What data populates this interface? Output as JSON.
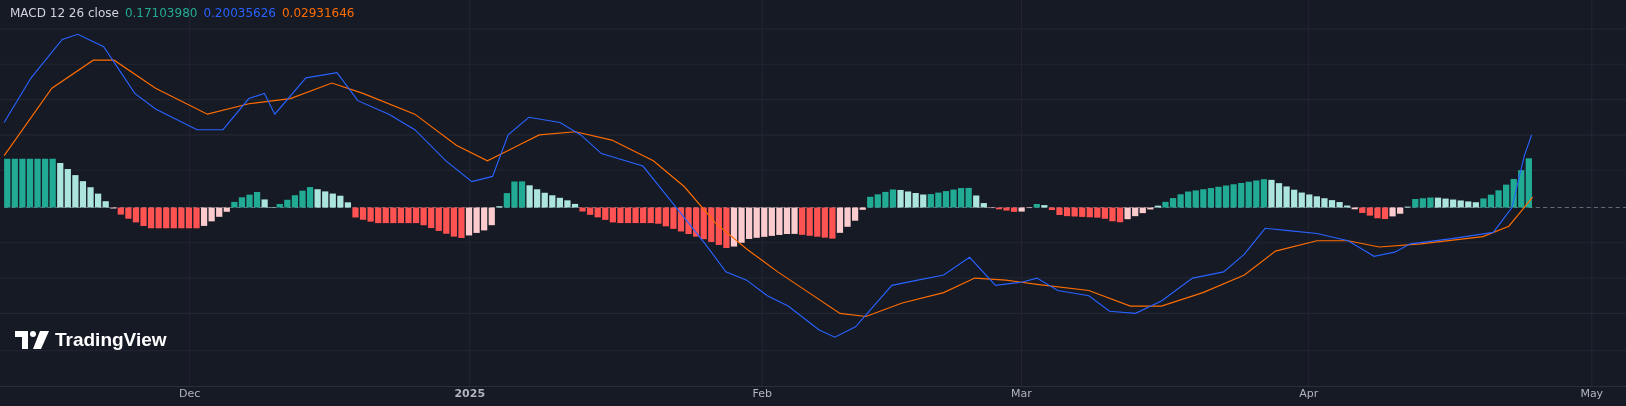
{
  "legend": {
    "title": "MACD 12 26 close",
    "values": [
      {
        "text": "0.17103980",
        "color": "#22ab94"
      },
      {
        "text": "0.20035626",
        "color": "#2962ff"
      },
      {
        "text": "0.02931646",
        "color": "#ff6d00"
      }
    ]
  },
  "logo": {
    "text": "TradingView"
  },
  "time_axis": {
    "labels": [
      {
        "text": "Dec",
        "kind": "month"
      },
      {
        "text": "2025",
        "kind": "year"
      },
      {
        "text": "Feb",
        "kind": "month"
      },
      {
        "text": "Mar",
        "kind": "month"
      },
      {
        "text": "Apr",
        "kind": "month"
      },
      {
        "text": "May",
        "kind": "month"
      }
    ]
  }
}
